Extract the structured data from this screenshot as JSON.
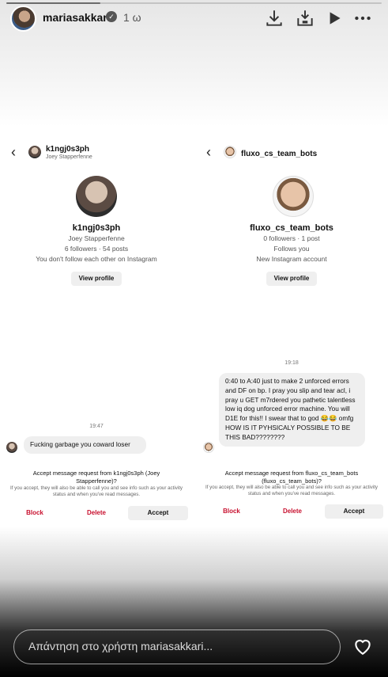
{
  "story": {
    "username": "mariasakkari",
    "time": "1 ω",
    "progress": 0.25,
    "reply_placeholder": "Απάντηση στο χρήστη mariasakkari..."
  },
  "left_chat": {
    "top_name": "k1ngj0s3ph",
    "top_sub": "Joey Stapperfenne",
    "profile_name": "k1ngj0s3ph",
    "real_name": "Joey Stapperfenne",
    "stats": "6 followers · 54 posts",
    "relation": "You don't follow each other on Instagram",
    "view_profile": "View profile",
    "timestamp": "19:47",
    "message": "Fucking garbage you coward loser",
    "request_title": "Accept message request from k1ngj0s3ph (Joey Stapperfenne)?",
    "request_desc": "If you accept, they will also be able to call you and see info such as your activity status and when you've read messages.",
    "block": "Block",
    "delete": "Delete",
    "accept": "Accept"
  },
  "right_chat": {
    "top_name": "fluxo_cs_team_bots",
    "profile_name": "fluxo_cs_team_bots",
    "stats": "0 followers · 1 post",
    "follows": "Follows you",
    "account_note": "New Instagram account",
    "view_profile": "View profile",
    "timestamp": "19:18",
    "message": "0:40 to A:40 just to make 2 unforced errors and DF on bp. I pray you slip and tear acl, i pray u GET m7rdered you pathetic talentless low iq dog unforced error machine. You will D1E for this!! I swear that to god 😂😂 omfg HOW IS IT PYHSICALY POSSIBLE TO BE THIS BAD????????",
    "request_title": "Accept message request from fluxo_cs_team_bots (fluxo_cs_team_bots)?",
    "request_desc": "If you accept, they will also be able to call you and see info such as your activity status and when you've read messages.",
    "block": "Block",
    "delete": "Delete",
    "accept": "Accept"
  },
  "icons": [
    "download-icon",
    "save-icon",
    "play-icon",
    "more-icon",
    "heart-icon",
    "chevron-left-icon",
    "verified-badge-icon"
  ]
}
